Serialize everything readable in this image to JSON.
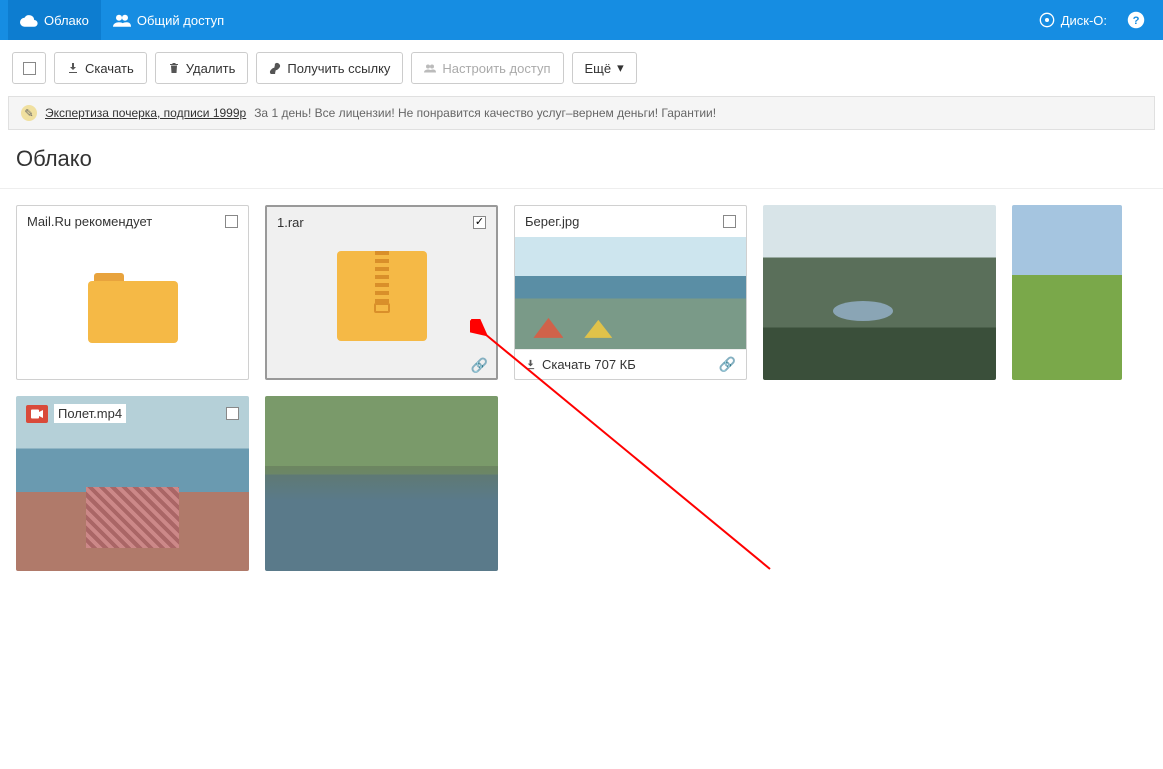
{
  "topnav": {
    "tab_cloud": "Облако",
    "tab_shared": "Общий доступ",
    "disk_o": "Диск-О:"
  },
  "toolbar": {
    "download": "Скачать",
    "delete": "Удалить",
    "get_link": "Получить ссылку",
    "configure_access": "Настроить доступ",
    "more": "Ещё"
  },
  "ad": {
    "link": "Экспертиза почерка, подписи 1999р",
    "text": "За 1 день! Все лицензии! Не понравится качество услуг–вернем деньги! Гарантии!"
  },
  "heading": "Облако",
  "files": [
    {
      "name": "Mail.Ru рекомендует",
      "type": "folder",
      "checked": false
    },
    {
      "name": "1.rar",
      "type": "archive",
      "checked": true
    },
    {
      "name": "Берег.jpg",
      "type": "image",
      "thumb": "landscape1",
      "download_label": "Скачать 707 КБ",
      "checked": false
    },
    {
      "name": "",
      "type": "image_bare",
      "thumb": "mountain"
    },
    {
      "name": "",
      "type": "image_bare",
      "thumb": "field"
    },
    {
      "name": "Полет.mp4",
      "type": "video",
      "thumb": "aerial",
      "checked": false
    },
    {
      "name": "",
      "type": "image_bare",
      "thumb": "lake"
    }
  ]
}
